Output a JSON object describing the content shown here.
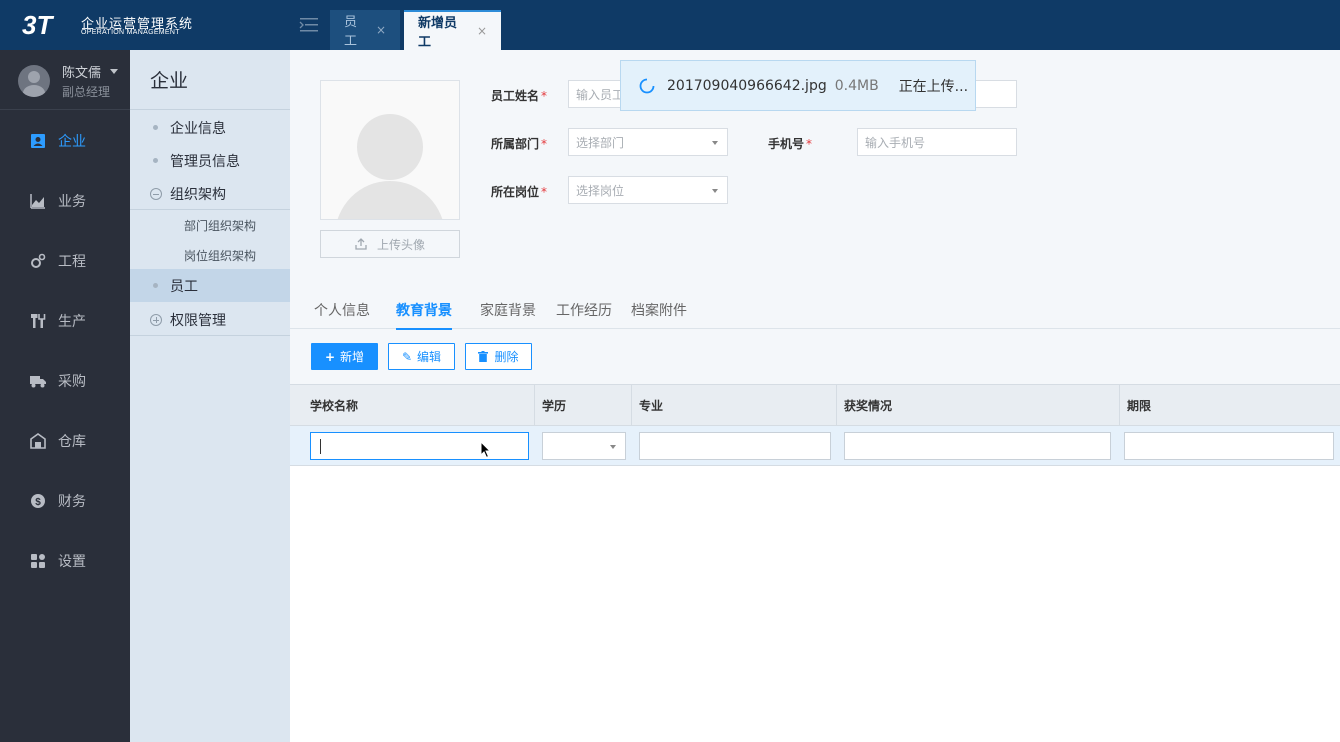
{
  "app": {
    "title": "企业运营管理系统",
    "subtitle": "OPERATION MANAGEMENT",
    "logo_text": "3T"
  },
  "tabs": [
    {
      "label": "员工",
      "close": "×"
    },
    {
      "label": "新增员工",
      "close": "×"
    }
  ],
  "user": {
    "name": "陈文儒",
    "role": "副总经理"
  },
  "nav": [
    {
      "label": "企业",
      "icon": "id-card-icon"
    },
    {
      "label": "业务",
      "icon": "chart-icon"
    },
    {
      "label": "工程",
      "icon": "gears-icon"
    },
    {
      "label": "生产",
      "icon": "tools-icon"
    },
    {
      "label": "采购",
      "icon": "truck-icon"
    },
    {
      "label": "仓库",
      "icon": "warehouse-icon"
    },
    {
      "label": "财务",
      "icon": "dollar-icon"
    },
    {
      "label": "设置",
      "icon": "grid-icon"
    }
  ],
  "subnav": {
    "title": "企业",
    "items": [
      {
        "label": "企业信息"
      },
      {
        "label": "管理员信息"
      },
      {
        "label": "组织架构"
      },
      {
        "label": "部门组织架构"
      },
      {
        "label": "岗位组织架构"
      },
      {
        "label": "员工"
      },
      {
        "label": "权限管理"
      }
    ]
  },
  "form": {
    "upload_label": "上传头像",
    "name_label": "员工姓名",
    "name_placeholder": "输入员工",
    "dept_label": "所属部门",
    "dept_placeholder": "选择部门",
    "phone_label": "手机号",
    "phone_placeholder": "输入手机号",
    "post_label": "所在岗位",
    "post_placeholder": "选择岗位",
    "required_mark": "*"
  },
  "toast": {
    "filename": "201709040966642.jpg",
    "size": "0.4MB",
    "status": "正在上传..."
  },
  "content_tabs": [
    "个人信息",
    "教育背景",
    "家庭背景",
    "工作经历",
    "档案附件"
  ],
  "buttons": {
    "add": "新增",
    "add_glyph": "+",
    "edit": "编辑",
    "edit_glyph": "✎",
    "delete": "删除",
    "delete_glyph": "🗑"
  },
  "table": {
    "columns": [
      "学校名称",
      "学历",
      "专业",
      "获奖情况",
      "期限"
    ]
  },
  "colors": {
    "topbar": "#0f3a66",
    "sidebar": "#2a2f3a",
    "accent": "#1890ff"
  }
}
